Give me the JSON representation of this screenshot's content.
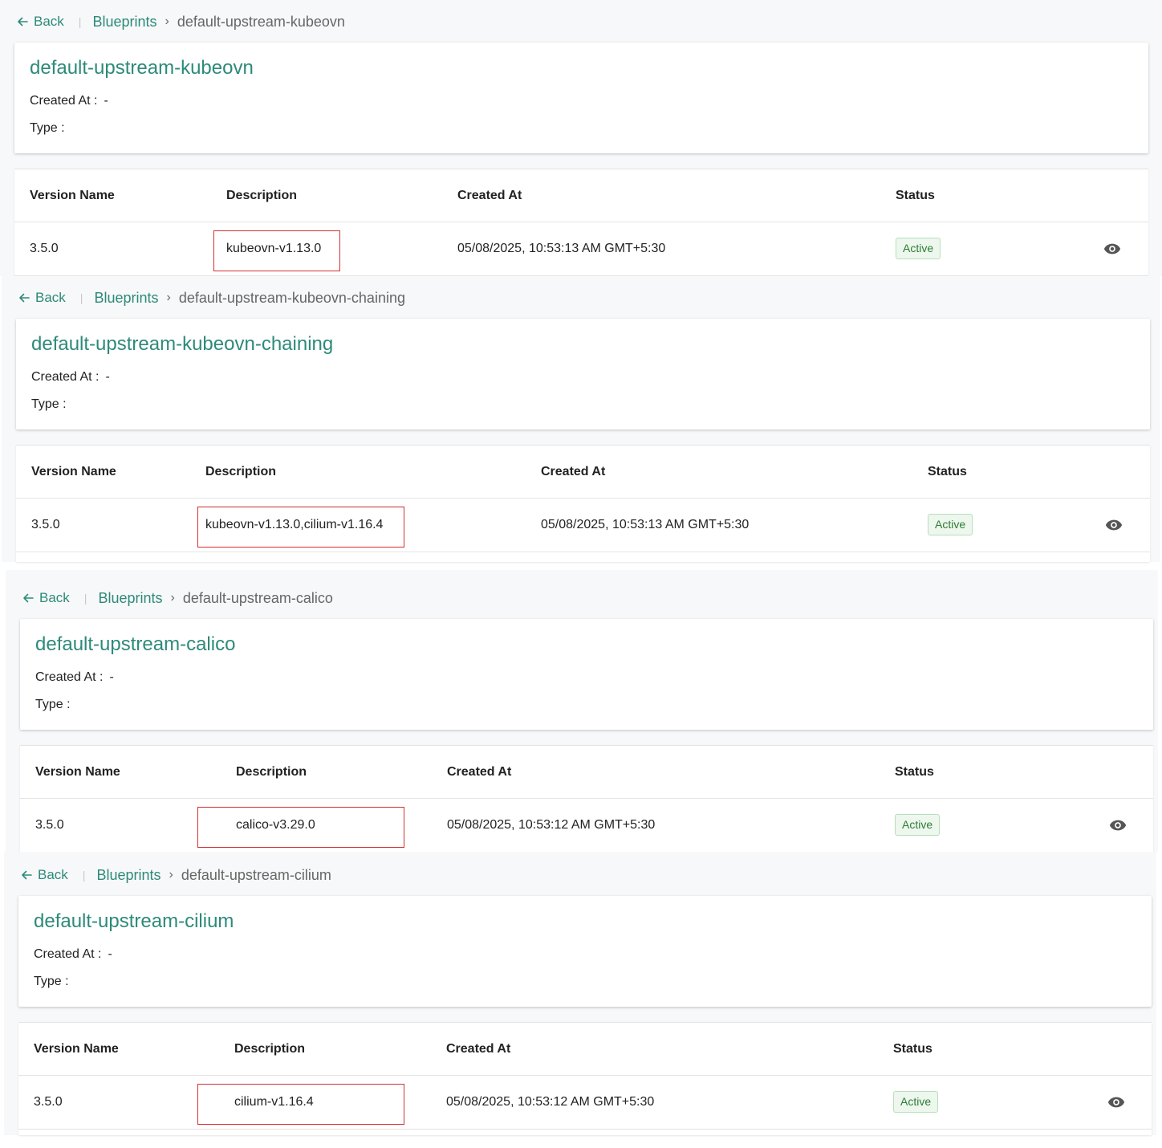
{
  "common": {
    "back_label": "Back",
    "breadcrumb_root": "Blueprints",
    "breadcrumb_separator": "›",
    "created_at_label": "Created At :",
    "type_label": "Type :",
    "columns": {
      "version_name": "Version Name",
      "description": "Description",
      "created_at": "Created At",
      "status": "Status"
    }
  },
  "colors": {
    "accent": "#2d8a7a",
    "highlight_border": "#d32f2f",
    "active_badge_text": "#2e7d32",
    "active_badge_bg": "#edf7ee"
  },
  "blueprints": [
    {
      "name": "default-upstream-kubeovn",
      "created_at": "-",
      "type": "",
      "version": {
        "name": "3.5.0",
        "description": "kubeovn-v1.13.0",
        "created_at": "05/08/2025, 10:53:13 AM GMT+5:30",
        "status": "Active",
        "action_icon": "eye-icon"
      }
    },
    {
      "name": "default-upstream-kubeovn-chaining",
      "created_at": "-",
      "type": "",
      "version": {
        "name": "3.5.0",
        "description": "kubeovn-v1.13.0,cilium-v1.16.4",
        "created_at": "05/08/2025, 10:53:13 AM GMT+5:30",
        "status": "Active",
        "action_icon": "eye-icon"
      }
    },
    {
      "name": "default-upstream-calico",
      "created_at": "-",
      "type": "",
      "version": {
        "name": "3.5.0",
        "description": "calico-v3.29.0",
        "created_at": "05/08/2025, 10:53:12 AM GMT+5:30",
        "status": "Active",
        "action_icon": "eye-icon"
      }
    },
    {
      "name": "default-upstream-cilium",
      "created_at": "-",
      "type": "",
      "version": {
        "name": "3.5.0",
        "description": "cilium-v1.16.4",
        "created_at": "05/08/2025, 10:53:12 AM GMT+5:30",
        "status": "Active",
        "action_icon": "eye-icon"
      }
    }
  ]
}
